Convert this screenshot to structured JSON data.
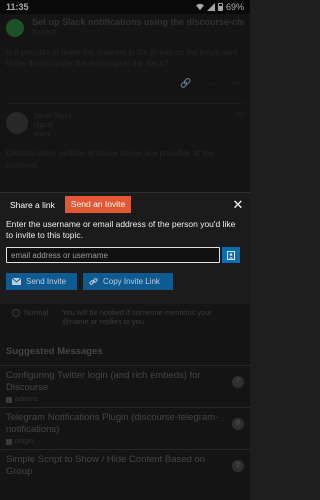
{
  "status_bar": {
    "time": "11:35",
    "battery": "69%",
    "battery_level": 0.69
  },
  "topic": {
    "title": "Set up Slack notifications using the discourse-cha...",
    "category": "Support",
    "first_post_text": "Is it possible to make the answers in the thread on the forum sent to the thread under the message in the slack?",
    "reply_author": "David Taylor",
    "reply_author_username": "djgoat",
    "reply_author_title": "team",
    "reply_date": "2d",
    "reply_text": "Unfortunately neither of those things are possible at the moment."
  },
  "share_modal": {
    "tab_share": "Share a link",
    "tab_invite": "Send an Invite",
    "description": "Enter the username or email address of the person you'd like to invite to this topic.",
    "input_placeholder": "email address or username",
    "send_button": "Send Invite",
    "copy_button": "Copy Invite Link"
  },
  "notification": {
    "level": "Normal",
    "description": "You will be notified if someone mentions your @name or replies to you."
  },
  "suggested": {
    "section_title": "Suggested Messages",
    "items": [
      {
        "title": "Configuring Twitter login (and rich embeds) for Discourse",
        "category": "admins",
        "count": "7"
      },
      {
        "title": "Telegram Notifications Plugin (discourse-telegram-notifications)",
        "category": "plugin",
        "count": "8"
      },
      {
        "title": "Simple Script to Show / Hide Content Based on Group",
        "category": "",
        "count": "2"
      }
    ]
  },
  "colors": {
    "invite_tab": "#e45735",
    "primary_button": "#0e5a91",
    "contact_button": "#0a6cb3"
  }
}
